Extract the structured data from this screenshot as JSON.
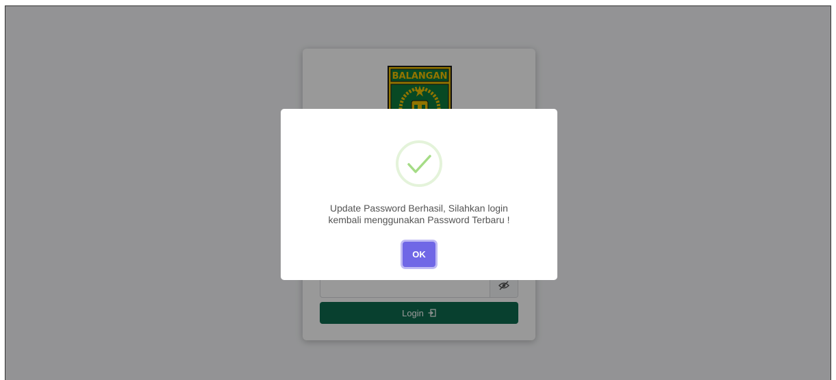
{
  "login": {
    "logo_text": "BALANGAN",
    "password_value": "",
    "login_label": "Login"
  },
  "dialog": {
    "message_line1": "Update Password Berhasil, Silahkan login",
    "message_line2": "kembali menggunakan Password Terbaru !",
    "ok_label": "OK",
    "icon": "check-circle-icon"
  },
  "colors": {
    "login_button": "#0e6b4f",
    "ok_button": "#7067e6",
    "success": "#a5dc86",
    "logo_green": "#0e7a3c",
    "logo_gold": "#f2c200"
  }
}
